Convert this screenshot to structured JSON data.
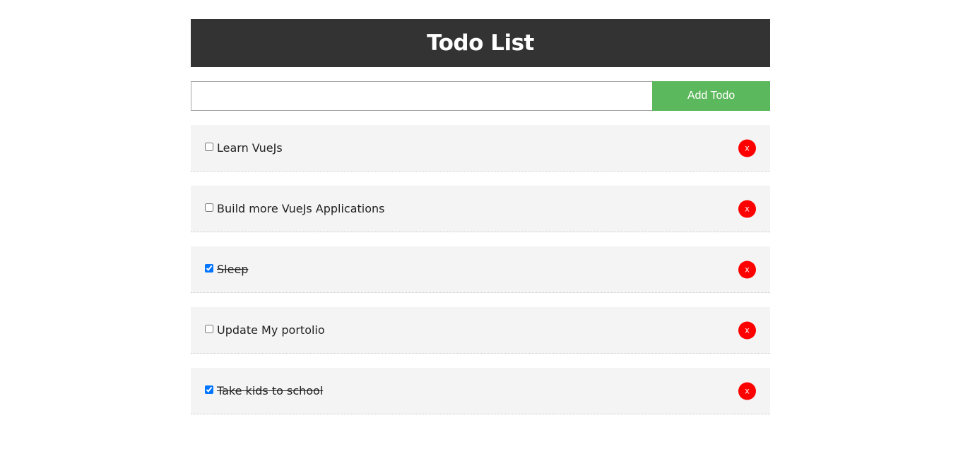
{
  "header": {
    "title": "Todo List"
  },
  "add_form": {
    "input_value": "",
    "button_label": "Add Todo"
  },
  "delete_label": "x",
  "colors": {
    "header_bg": "#333333",
    "add_button": "#5cb85c",
    "delete_button": "#ff0000",
    "item_bg": "#f4f4f4"
  },
  "todos": [
    {
      "title": "Learn VueJs",
      "completed": false
    },
    {
      "title": "Build more VueJs Applications",
      "completed": false
    },
    {
      "title": "Sleep",
      "completed": true
    },
    {
      "title": "Update My portolio",
      "completed": false
    },
    {
      "title": "Take kids to school",
      "completed": true
    }
  ]
}
